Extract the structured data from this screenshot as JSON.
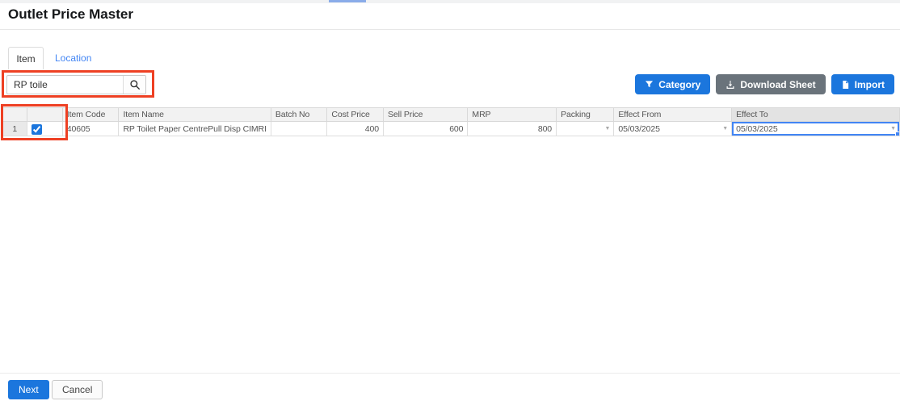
{
  "header": {
    "title": "Outlet Price Master"
  },
  "tabs": [
    {
      "label": "Item",
      "active": true
    },
    {
      "label": "Location",
      "active": false
    }
  ],
  "search": {
    "value": "RP toile"
  },
  "toolbar": {
    "category_label": "Category",
    "download_label": "Download Sheet",
    "import_label": "Import"
  },
  "table": {
    "columns": [
      "",
      "",
      "Item Code",
      "Item Name",
      "Batch No",
      "Cost Price",
      "Sell Price",
      "MRP",
      "Packing",
      "Effect From",
      "Effect To"
    ],
    "selected_column": "Effect To",
    "rows": [
      {
        "index": "1",
        "checked": true,
        "item_code": "40605",
        "item_name": "RP Toilet Paper CentrePull Disp CIMRI",
        "batch_no": "",
        "cost_price": "400",
        "sell_price": "600",
        "mrp": "800",
        "packing": "",
        "effect_from": "05/03/2025",
        "effect_to": "05/03/2025"
      }
    ]
  },
  "footer": {
    "next_label": "Next",
    "cancel_label": "Cancel"
  },
  "icons": {
    "search": "magnifier-icon",
    "category": "filter-funnel-icon",
    "download": "download-tray-icon",
    "import": "file-icon",
    "dropdown_glyph": "▼"
  },
  "colors": {
    "primary_blue": "#1b76dd",
    "secondary_gray": "#6a737b",
    "link_blue": "#4285f4",
    "focus_blue": "#4285f4",
    "annotation_red": "#ee4023",
    "selected_header_bg": "#e3e3e3"
  }
}
